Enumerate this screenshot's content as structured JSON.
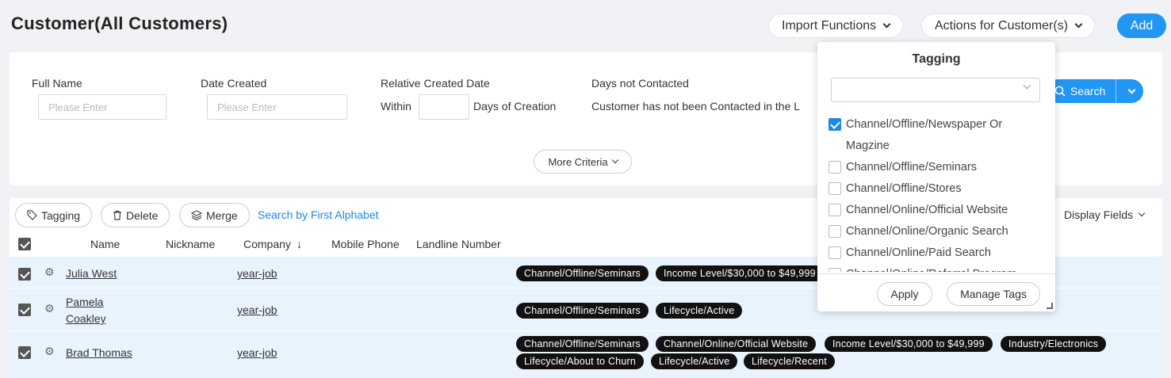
{
  "page": {
    "title": "Customer(All Customers)"
  },
  "header": {
    "import_label": "Import Functions",
    "actions_label": "Actions for Customer(s)",
    "add_label": "Add"
  },
  "filters": {
    "full_name_label": "Full Name",
    "full_name_placeholder": "Please Enter",
    "date_created_label": "Date Created",
    "date_created_placeholder": "Please Enter",
    "relative_label": "Relative Created Date",
    "within_label": "Within",
    "days_creation_label": "Days of Creation",
    "not_contacted_label": "Days not Contacted",
    "not_contacted_text": "Customer has not been Contacted in the L",
    "more_criteria_label": "More Criteria",
    "search_label": "Search"
  },
  "toolbar": {
    "tagging_label": "Tagging",
    "delete_label": "Delete",
    "merge_label": "Merge",
    "alphabet_label": "Search by First Alphabet",
    "display_fields_label": "Display Fields"
  },
  "table": {
    "columns": [
      "Name",
      "Nickname",
      "Company",
      "Mobile Phone",
      "Landline Number"
    ],
    "sort_indicator": "↓",
    "rows": [
      {
        "name": "Julia West",
        "company": "year-job",
        "checked": true,
        "tags": [
          "Channel/Offline/Seminars",
          "Income Level/$30,000 to $49,999"
        ]
      },
      {
        "name_line1": "Pamela",
        "name_line2": "Coakley",
        "company": "year-job",
        "checked": true,
        "tags": [
          "Channel/Offline/Seminars",
          "Lifecycle/Active"
        ]
      },
      {
        "name": "Brad Thomas",
        "company": "year-job",
        "checked": true,
        "tags": [
          "Channel/Offline/Seminars",
          "Channel/Online/Official Website",
          "Income Level/$30,000 to $49,999",
          "Industry/Electronics",
          "Lifecycle/About to Churn",
          "Lifecycle/Active",
          "Lifecycle/Recent"
        ]
      }
    ]
  },
  "tagging_popover": {
    "title": "Tagging",
    "options": [
      {
        "line1": "Channel/Offline/Newspaper Or",
        "line2": "Magzine",
        "checked": true
      },
      {
        "label": "Channel/Offline/Seminars",
        "checked": false
      },
      {
        "label": "Channel/Offline/Stores",
        "checked": false
      },
      {
        "label": "Channel/Online/Official Website",
        "checked": false
      },
      {
        "label": "Channel/Online/Organic Search",
        "checked": false
      },
      {
        "label": "Channel/Online/Paid Search",
        "checked": false
      },
      {
        "label": "Channel/Online/Referral Program",
        "checked": false
      }
    ],
    "apply_label": "Apply",
    "manage_label": "Manage Tags"
  },
  "colors": {
    "accent": "#2196f3",
    "row_highlight": "#e8f3fd",
    "tag_bg": "#111111"
  }
}
